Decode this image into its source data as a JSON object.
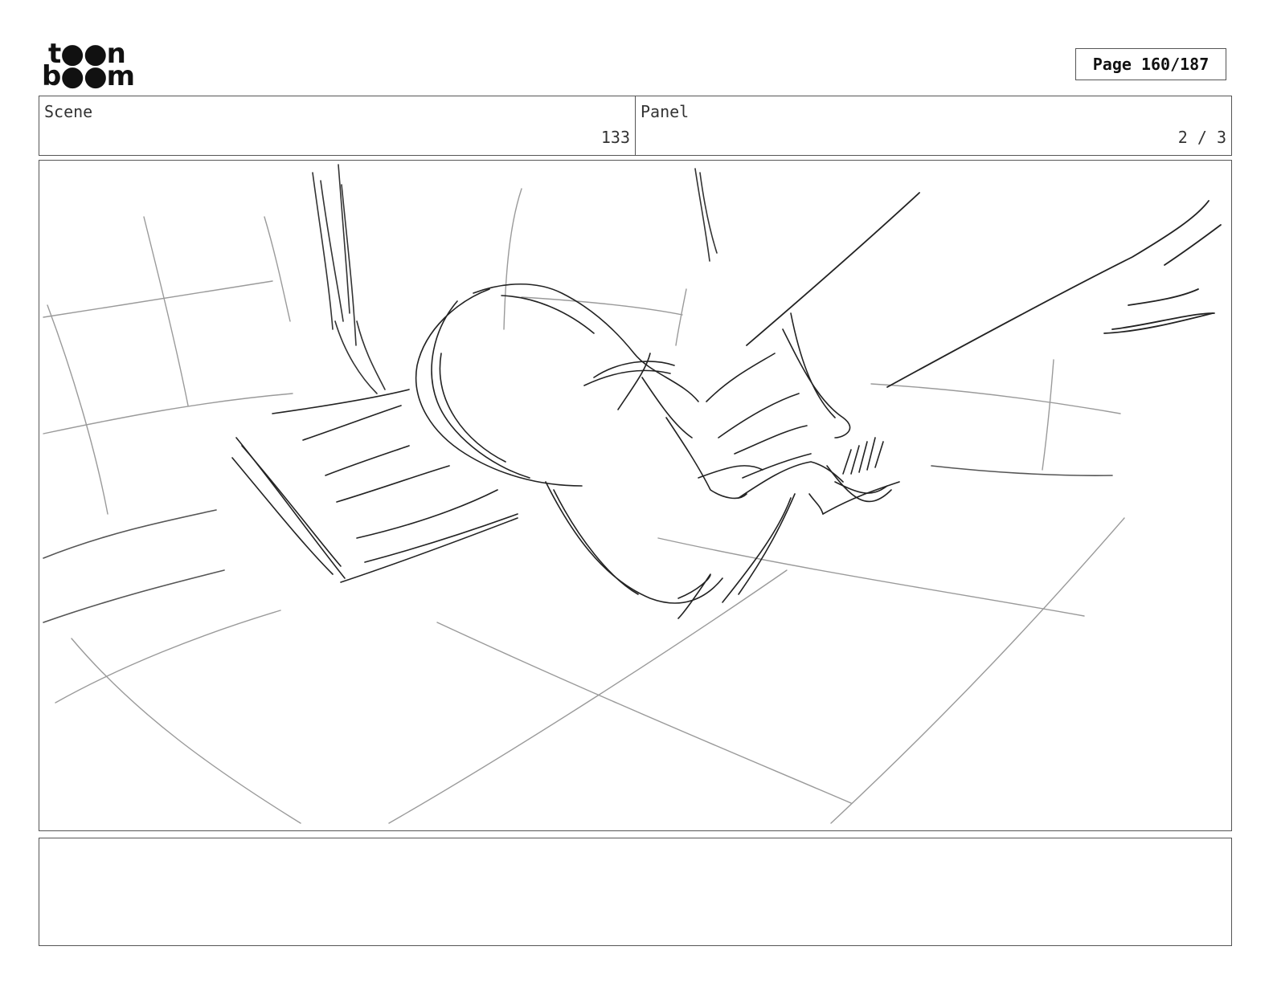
{
  "header": {
    "logo_top": "t●●n",
    "logo_bottom": "b●●m",
    "page_indicator": "Page 160/187"
  },
  "info": {
    "scene_label": "Scene",
    "scene_value": "133",
    "panel_label": "Panel",
    "panel_value": "2 / 3"
  },
  "notes": {
    "text": ""
  }
}
